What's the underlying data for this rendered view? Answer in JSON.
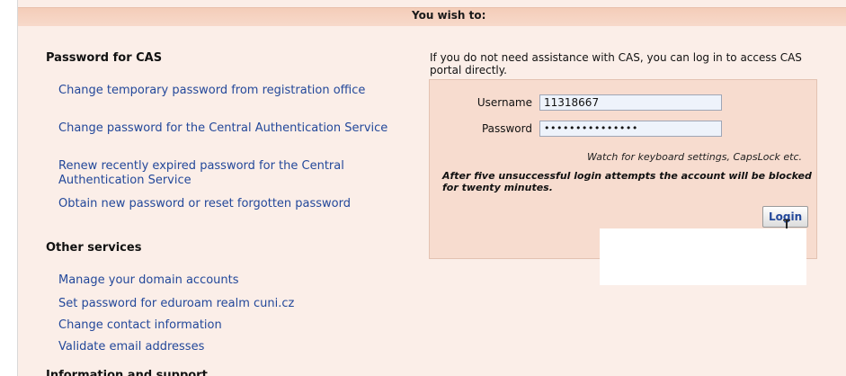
{
  "header": {
    "title": "You wish to:"
  },
  "password_section": {
    "heading": "Password for CAS",
    "links": [
      "Change temporary password from registration office",
      "Change password for the Central Authentication Service",
      "Renew recently expired password for the Central Authentication Service",
      "Obtain new password or reset forgotten password"
    ]
  },
  "other_section": {
    "heading": "Other services",
    "links": [
      "Manage your domain accounts",
      "Set password for eduroam realm cuni.cz",
      "Change contact information",
      "Validate email addresses"
    ]
  },
  "info_section": {
    "heading": "Information and support"
  },
  "login": {
    "intro": "If you do not need assistance with CAS, you can log in to access CAS portal directly.",
    "username_label": "Username",
    "username_value": "11318667",
    "password_label": "Password",
    "password_value": "•••••••••••••••",
    "hint": "Watch for keyboard settings, CapsLock etc.",
    "warning": "After five unsuccessful login attempts the account will be blocked for twenty minutes.",
    "button_label": "Login"
  },
  "colors": {
    "page_background": "#fbeee8",
    "header_band": "#f5d3c2",
    "login_box": "#f7dccf",
    "link": "#23489a"
  },
  "icons": {
    "cursor": "mouse-pointer-icon"
  }
}
